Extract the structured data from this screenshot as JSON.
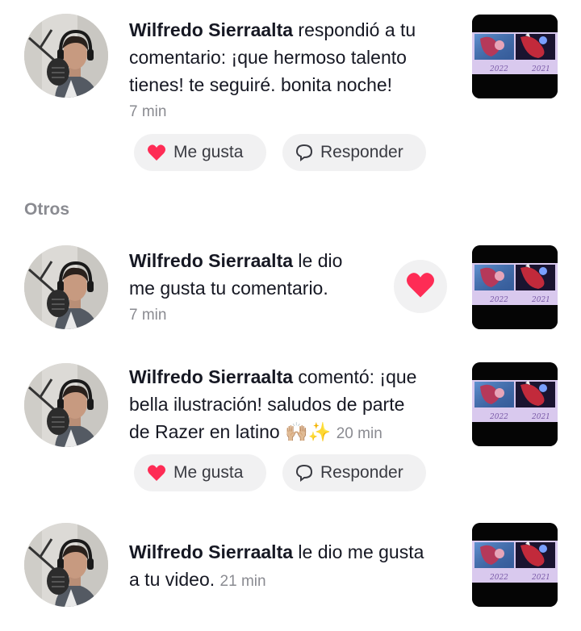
{
  "colors": {
    "accent": "#fe2c55",
    "muted": "#8a8b91",
    "pill_bg": "#f1f1f2"
  },
  "section_other": "Otros",
  "notifications": [
    {
      "user": "Wilfredo Sierraalta",
      "line1_rest": "respondió a tu",
      "line2": "comentario: ¡que hermoso talento",
      "line3": "tienes! te seguiré. bonita noche!",
      "time": "7 min",
      "like_label": "Me gusta",
      "reply_label": "Responder"
    },
    {
      "user": "Wilfredo Sierraalta",
      "line1_rest": "le dio",
      "line2": "me gusta tu comentario.",
      "time": "7 min",
      "liked_icon": "heart-icon"
    },
    {
      "user": "Wilfredo Sierraalta",
      "line1_rest": "comentó: ¡que",
      "line2": "bella ilustración! saludos de parte",
      "line3": "de Razer en latino 🙌🏼✨",
      "time": "20 min",
      "like_label": "Me gusta",
      "reply_label": "Responder"
    },
    {
      "user": "Wilfredo Sierraalta",
      "line1_rest": "le dio me gusta",
      "line2": "a tu video.",
      "time": "21 min"
    }
  ],
  "thumbnail": {
    "year_left": "2022",
    "year_right": "2021"
  }
}
